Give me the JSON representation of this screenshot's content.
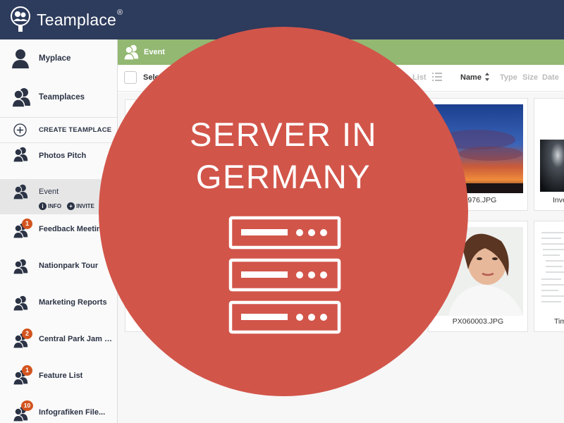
{
  "app": {
    "name": "Teamplace",
    "trademark": "®",
    "colors": {
      "header": "#2d3b5c",
      "event_bar": "#92b872",
      "badge": "#d3541f",
      "overlay": "#d2554a"
    }
  },
  "sidebar": {
    "items": [
      {
        "label": "Myplace",
        "icon": "person-icon"
      },
      {
        "label": "Teamplaces",
        "icon": "group-icon"
      },
      {
        "label": "CREATE TEAMPLACE",
        "icon": "add-circle-icon"
      },
      {
        "label": "Photos Pitch",
        "icon": "group-icon"
      },
      {
        "label": "Event",
        "icon": "group-icon",
        "active": true,
        "actions": [
          "INFO",
          "INVITE"
        ]
      },
      {
        "label": "Feedback Meeting",
        "icon": "group-icon",
        "badge": "1"
      },
      {
        "label": "Nationpark Tour",
        "icon": "group-icon"
      },
      {
        "label": "Marketing Reports",
        "icon": "group-icon"
      },
      {
        "label": "Central Park Jam Se...",
        "icon": "group-icon",
        "badge": "2"
      },
      {
        "label": "Feature List",
        "icon": "group-icon",
        "badge": "1"
      },
      {
        "label": "Infografiken File...",
        "icon": "group-icon",
        "badge": "10"
      }
    ]
  },
  "main": {
    "title": "Event",
    "toolbar": {
      "select_label": "Sele",
      "view_label": "List",
      "sort_options": [
        "Name",
        "Type",
        "Size",
        "Date"
      ],
      "active_sort": "Name"
    },
    "files": [
      {
        "name": "_7976.JPG"
      },
      {
        "name": "Inve"
      },
      {
        "name": "PX060003.JPG"
      },
      {
        "name": "Tim"
      }
    ]
  },
  "overlay": {
    "line1": "SERVER IN",
    "line2": "GERMANY",
    "icon": "server-icon"
  }
}
